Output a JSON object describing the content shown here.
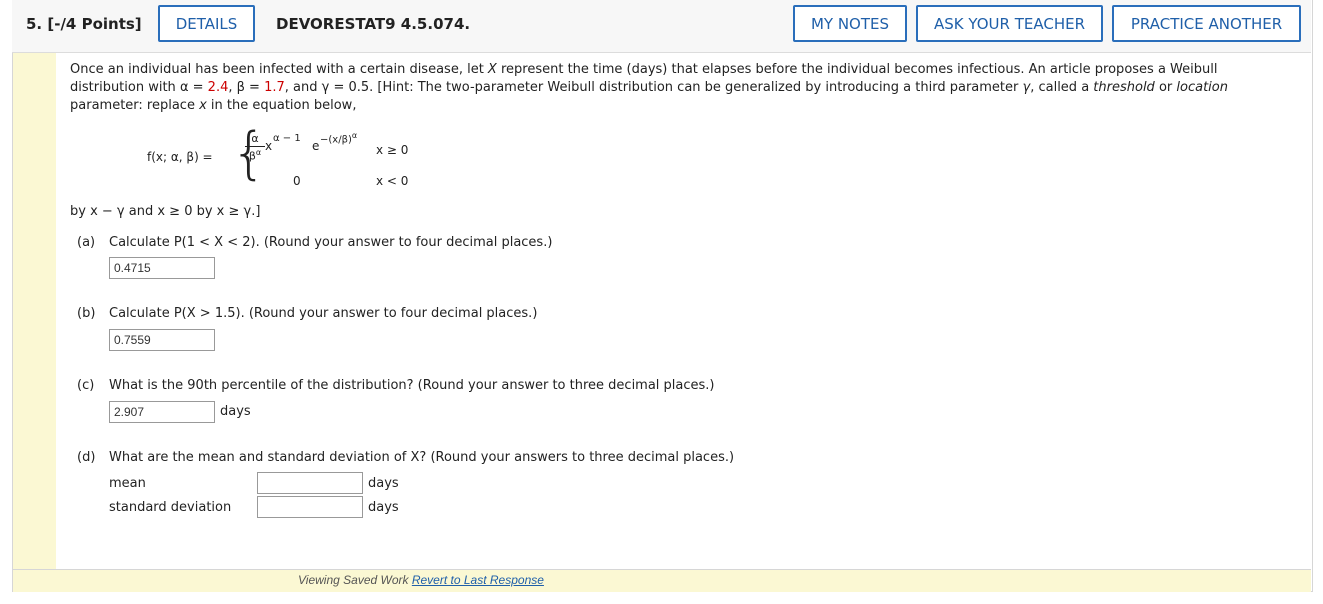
{
  "header": {
    "question_number": "5.",
    "points": "[-/4 Points]",
    "details_label": "DETAILS",
    "question_code": "DEVORESTAT9 4.5.074.",
    "my_notes_label": "MY NOTES",
    "ask_teacher_label": "ASK YOUR TEACHER",
    "practice_label": "PRACTICE ANOTHER"
  },
  "intro": {
    "line1_a": "Once an individual has been infected with a certain disease, let ",
    "X": "X",
    "line1_b": " represent the time (days) that elapses before the individual becomes infectious. An article proposes a Weibull",
    "line2_a": "distribution with ",
    "alpha_eq": "α = ",
    "alpha_val": "2.4",
    "beta_eq": ", β = ",
    "beta_val": "1.7",
    "gamma_eq": ", and γ = 0.5. [Hint: The two-parameter Weibull distribution can be generalized by introducing a third parameter ",
    "gamma": "γ",
    "line2_b": ", called a ",
    "threshold": "threshold",
    "or": " or ",
    "location": "location",
    "line3_a": "parameter: replace ",
    "x": "x",
    "line3_b": " in the equation below,"
  },
  "formula": {
    "lhs": "f(x; α, β) =",
    "num": "α",
    "den": "β",
    "den_sup": "α",
    "x": "x",
    "x_sup": "α − 1",
    "e": "e",
    "e_sup": "−(x/β)",
    "e_sup2": "α",
    "cond1": "x ≥ 0",
    "zero": "0",
    "cond2": "x < 0"
  },
  "byline": "by x − γ and x ≥ 0 by x ≥ γ.]",
  "parts": {
    "a": {
      "label": "(a)",
      "text": "Calculate P(1 < X < 2). (Round your answer to four decimal places.)",
      "value": "0.4715"
    },
    "b": {
      "label": "(b)",
      "text": "Calculate P(X > 1.5). (Round your answer to four decimal places.)",
      "value": "0.7559"
    },
    "c": {
      "label": "(c)",
      "text": "What is the 90th percentile of the distribution? (Round your answer to three decimal places.)",
      "value": "2.907",
      "unit": "days"
    },
    "d": {
      "label": "(d)",
      "text": "What are the mean and standard deviation of X? (Round your answers to three decimal places.)",
      "mean_label": "mean",
      "mean_value": "",
      "mean_unit": "days",
      "sd_label": "standard deviation",
      "sd_value": "",
      "sd_unit": "days"
    }
  },
  "footer": {
    "saved_text": "Viewing Saved Work ",
    "revert_label": "Revert to Last Response"
  }
}
